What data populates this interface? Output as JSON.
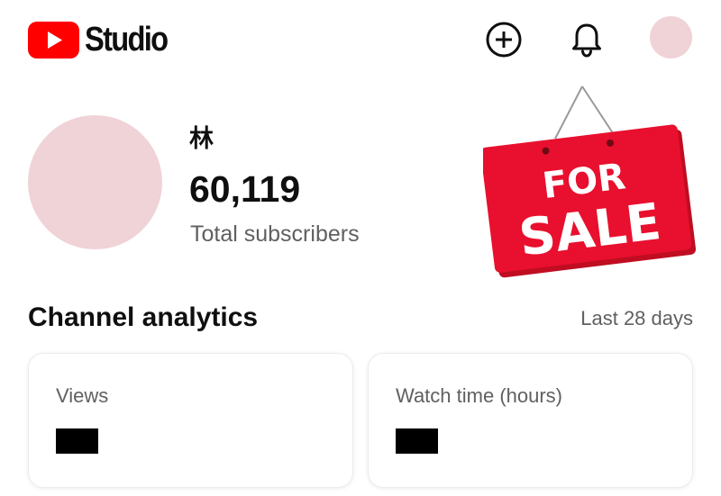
{
  "colors": {
    "brand_red": "#ff0000",
    "avatar_placeholder": "#f0d3d7",
    "text_primary": "#0f0f0f",
    "text_secondary": "#606060",
    "sale_red": "#e8102e"
  },
  "header": {
    "app_name": "Studio",
    "logo_icon": "youtube-play-logo",
    "create_icon": "plus-circle-icon",
    "notifications_icon": "bell-icon",
    "account_icon": "avatar"
  },
  "channel": {
    "name": "林",
    "subscriber_count": "60,119",
    "subscriber_label": "Total subscribers"
  },
  "sale_sign": {
    "line1": "FOR",
    "line2": "SALE"
  },
  "analytics": {
    "title": "Channel analytics",
    "period": "Last 28 days",
    "cards": [
      {
        "label": "Views",
        "value_redacted": true
      },
      {
        "label": "Watch time (hours)",
        "value_redacted": true
      }
    ]
  }
}
